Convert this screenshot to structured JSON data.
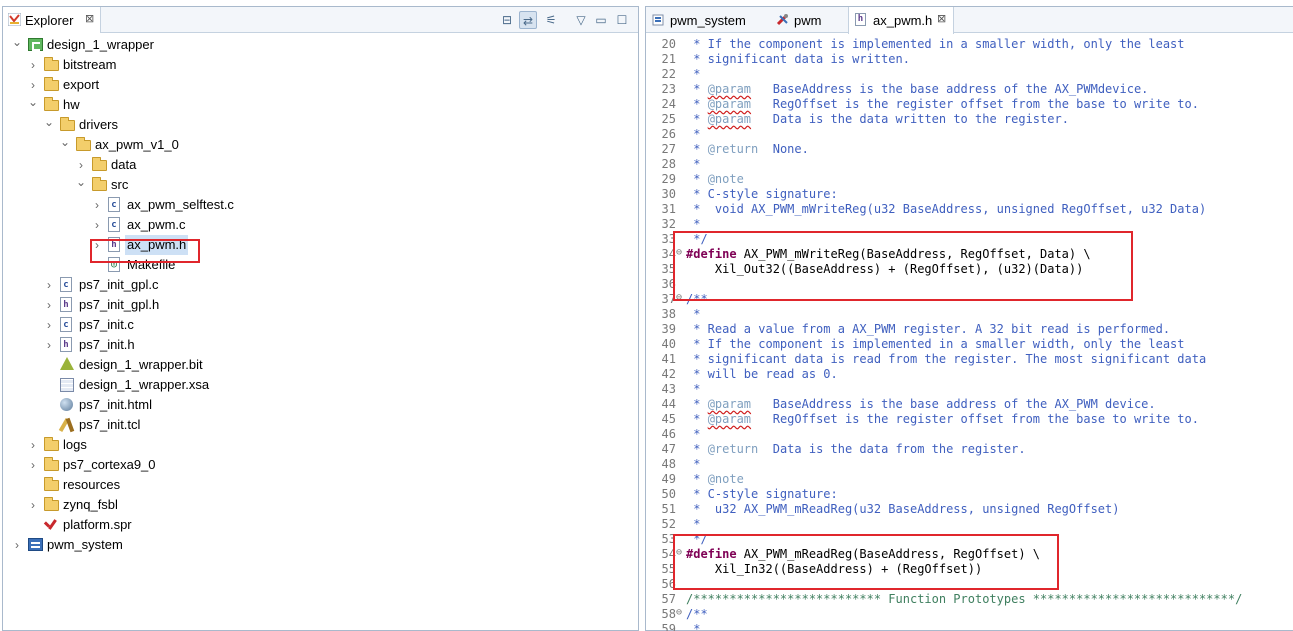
{
  "explorer": {
    "tab_label": "Explorer",
    "tab_close": "⊠",
    "tree": [
      {
        "label": "design_1_wrapper",
        "icon": "project-icon",
        "depth": 0,
        "twisty": "open"
      },
      {
        "label": "bitstream",
        "icon": "folder-icon",
        "depth": 1,
        "twisty": "closed"
      },
      {
        "label": "export",
        "icon": "folder-icon",
        "depth": 1,
        "twisty": "closed"
      },
      {
        "label": "hw",
        "icon": "folder-icon",
        "depth": 1,
        "twisty": "open"
      },
      {
        "label": "drivers",
        "icon": "folder-icon",
        "depth": 2,
        "twisty": "open"
      },
      {
        "label": "ax_pwm_v1_0",
        "icon": "folder-icon",
        "depth": 3,
        "twisty": "open"
      },
      {
        "label": "data",
        "icon": "folder-icon",
        "depth": 4,
        "twisty": "closed"
      },
      {
        "label": "src",
        "icon": "folder-icon",
        "depth": 4,
        "twisty": "open"
      },
      {
        "label": "ax_pwm_selftest.c",
        "icon": "c-file-icon",
        "depth": 5,
        "twisty": "closed"
      },
      {
        "label": "ax_pwm.c",
        "icon": "c-file-icon",
        "depth": 5,
        "twisty": "closed"
      },
      {
        "label": "ax_pwm.h",
        "icon": "h-file-icon",
        "depth": 5,
        "twisty": "closed",
        "selected": true
      },
      {
        "label": "Makefile",
        "icon": "makefile-icon",
        "depth": 5,
        "twisty": "none"
      },
      {
        "label": "ps7_init_gpl.c",
        "icon": "c-file-icon",
        "depth": 2,
        "twisty": "closed"
      },
      {
        "label": "ps7_init_gpl.h",
        "icon": "h-file-icon",
        "depth": 2,
        "twisty": "closed"
      },
      {
        "label": "ps7_init.c",
        "icon": "c-file-icon",
        "depth": 2,
        "twisty": "closed"
      },
      {
        "label": "ps7_init.h",
        "icon": "h-file-icon",
        "depth": 2,
        "twisty": "closed"
      },
      {
        "label": "design_1_wrapper.bit",
        "icon": "bitstream-icon",
        "depth": 2,
        "twisty": "none"
      },
      {
        "label": "design_1_wrapper.xsa",
        "icon": "xsa-icon",
        "depth": 2,
        "twisty": "none"
      },
      {
        "label": "ps7_init.html",
        "icon": "html-icon",
        "depth": 2,
        "twisty": "none"
      },
      {
        "label": "ps7_init.tcl",
        "icon": "tcl-icon",
        "depth": 2,
        "twisty": "none"
      },
      {
        "label": "logs",
        "icon": "folder-icon",
        "depth": 1,
        "twisty": "closed"
      },
      {
        "label": "ps7_cortexa9_0",
        "icon": "folder-icon",
        "depth": 1,
        "twisty": "closed"
      },
      {
        "label": "resources",
        "icon": "folder-icon",
        "depth": 1,
        "twisty": "none"
      },
      {
        "label": "zynq_fsbl",
        "icon": "folder-icon",
        "depth": 1,
        "twisty": "closed"
      },
      {
        "label": "platform.spr",
        "icon": "platform-spr-icon",
        "depth": 1,
        "twisty": "none"
      },
      {
        "label": "pwm_system",
        "icon": "system-project-icon",
        "depth": 0,
        "twisty": "closed"
      }
    ]
  },
  "editor": {
    "tabs": [
      {
        "label": "pwm_system",
        "icon": "system-icon",
        "active": false
      },
      {
        "label": "pwm",
        "icon": "tools-icon",
        "active": false
      },
      {
        "label": "ax_pwm.h",
        "icon": "h-file-icon",
        "active": true,
        "close": "⊠"
      }
    ],
    "lines": [
      {
        "n": "20",
        "kind": "doc",
        "text": " * If the component is implemented in a smaller width, only the least"
      },
      {
        "n": "21",
        "kind": "doc",
        "text": " * significant data is written."
      },
      {
        "n": "22",
        "kind": "doc",
        "text": " *"
      },
      {
        "n": "23",
        "kind": "doc",
        "text": " * @param   BaseAddress is the base address of the AX_PWMdevice."
      },
      {
        "n": "24",
        "kind": "doc",
        "text": " * @param   RegOffset is the register offset from the base to write to."
      },
      {
        "n": "25",
        "kind": "doc",
        "text": " * @param   Data is the data written to the register."
      },
      {
        "n": "26",
        "kind": "doc",
        "text": " *"
      },
      {
        "n": "27",
        "kind": "doc",
        "text": " * @return  None."
      },
      {
        "n": "28",
        "kind": "doc",
        "text": " *"
      },
      {
        "n": "29",
        "kind": "doc",
        "text": " * @note"
      },
      {
        "n": "30",
        "kind": "doc",
        "text": " * C-style signature:"
      },
      {
        "n": "31",
        "kind": "doc",
        "text": " *  void AX_PWM_mWriteReg(u32 BaseAddress, unsigned RegOffset, u32 Data)"
      },
      {
        "n": "32",
        "kind": "doc",
        "text": " *"
      },
      {
        "n": "33",
        "kind": "doc",
        "text": " */"
      },
      {
        "n": "34",
        "kind": "define",
        "fold": "⊖",
        "pp": "#define",
        "text": " AX_PWM_mWriteReg(BaseAddress, RegOffset, Data) \\"
      },
      {
        "n": "35",
        "kind": "plain",
        "text": "    Xil_Out32((BaseAddress) + (RegOffset), (u32)(Data))"
      },
      {
        "n": "36",
        "kind": "plain",
        "text": ""
      },
      {
        "n": "37",
        "kind": "doc",
        "fold": "⊖",
        "text": "/**"
      },
      {
        "n": "38",
        "kind": "doc",
        "text": " *"
      },
      {
        "n": "39",
        "kind": "doc",
        "text": " * Read a value from a AX_PWM register. A 32 bit read is performed."
      },
      {
        "n": "40",
        "kind": "doc",
        "text": " * If the component is implemented in a smaller width, only the least"
      },
      {
        "n": "41",
        "kind": "doc",
        "text": " * significant data is read from the register. The most significant data"
      },
      {
        "n": "42",
        "kind": "doc",
        "text": " * will be read as 0."
      },
      {
        "n": "43",
        "kind": "doc",
        "text": " *"
      },
      {
        "n": "44",
        "kind": "doc",
        "text": " * @param   BaseAddress is the base address of the AX_PWM device."
      },
      {
        "n": "45",
        "kind": "doc",
        "text": " * @param   RegOffset is the register offset from the base to write to."
      },
      {
        "n": "46",
        "kind": "doc",
        "text": " *"
      },
      {
        "n": "47",
        "kind": "doc",
        "text": " * @return  Data is the data from the register."
      },
      {
        "n": "48",
        "kind": "doc",
        "text": " *"
      },
      {
        "n": "49",
        "kind": "doc",
        "text": " * @note"
      },
      {
        "n": "50",
        "kind": "doc",
        "text": " * C-style signature:"
      },
      {
        "n": "51",
        "kind": "doc",
        "text": " *  u32 AX_PWM_mReadReg(u32 BaseAddress, unsigned RegOffset)"
      },
      {
        "n": "52",
        "kind": "doc",
        "text": " *"
      },
      {
        "n": "53",
        "kind": "doc",
        "text": " */"
      },
      {
        "n": "54",
        "kind": "define",
        "fold": "⊖",
        "pp": "#define",
        "text": " AX_PWM_mReadReg(BaseAddress, RegOffset) \\"
      },
      {
        "n": "55",
        "kind": "plain",
        "text": "    Xil_In32((BaseAddress) + (RegOffset))"
      },
      {
        "n": "56",
        "kind": "plain",
        "text": ""
      },
      {
        "n": "57",
        "kind": "comment",
        "text": "/************************** Function Prototypes ****************************/"
      },
      {
        "n": "58",
        "kind": "doc",
        "fold": "⊖",
        "text": "/**"
      },
      {
        "n": "59",
        "kind": "doc",
        "text": " *"
      }
    ]
  },
  "colors": {
    "highlight_box": "#e0262c",
    "doc_comment": "#3f5fbf",
    "javadoc_tag": "#7f9fbf",
    "preprocessor": "#7f0055",
    "comment": "#3f7f5f"
  }
}
